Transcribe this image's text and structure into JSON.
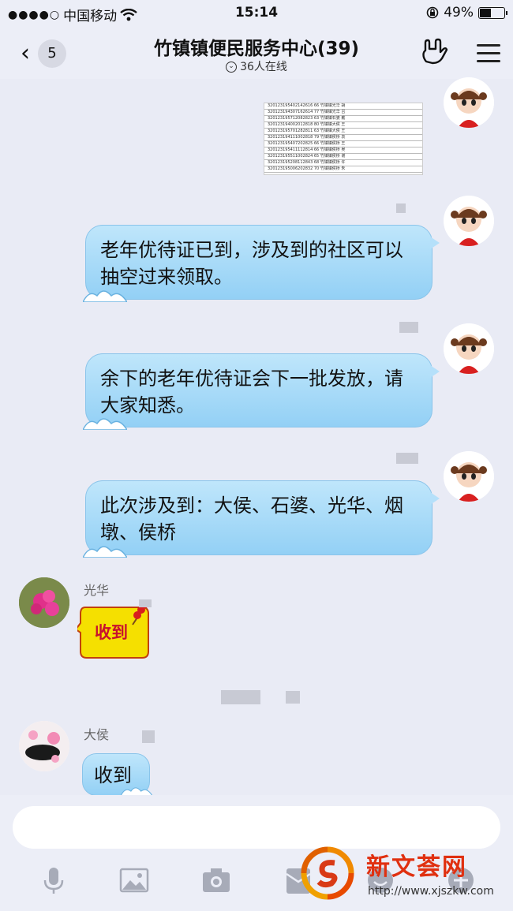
{
  "status": {
    "carrier": "中国移动",
    "time": "15:14",
    "battery": "49%",
    "battery_level": 0.49
  },
  "header": {
    "back_count": "5",
    "title": "竹镇镇便民服务中心(39)",
    "online": "36人在线"
  },
  "messages": [
    {
      "text": "老年优待证已到，涉及到的社区可以抽空过来领取。"
    },
    {
      "text": "余下的老年优待证会下一批发放，请大家知悉。"
    },
    {
      "text": "此次涉及到：大侯、石婆、光华、烟墩、侯桥"
    }
  ],
  "others": [
    {
      "name": "光华",
      "text": "收到"
    },
    {
      "name": "大侯",
      "text": "收到"
    }
  ],
  "image_rows": [
    "320123195402142616  66  竹镇镇光华  胡",
    "320123194307162614  77  竹镇镇光华  吕",
    "320123195712082823  63  竹镇镇石婆  戴",
    "320123194002012818  80  竹镇镇大侯  王",
    "320123195701282811  63  竹镇镇大侯  王",
    "320123194111002818  79  竹镇镇侯桥  袁",
    "320123195407202825  66  竹镇镇侯桥  王",
    "320123195411112814  66  竹镇镇侯桥  吴",
    "320123195511002824  65  竹镇镇侯桥  谢",
    "320123195208112843  68  竹镇镇侯桥  许",
    "320123195006202832  70  竹镇镇侯桥  朱"
  ],
  "watermark": {
    "brand": "新文荟网",
    "url": "http://www.xjszkw.com"
  },
  "colors": {
    "bubble": "#a9dbf7",
    "sticker": "#f5e000",
    "background": "#e9ebf5"
  }
}
